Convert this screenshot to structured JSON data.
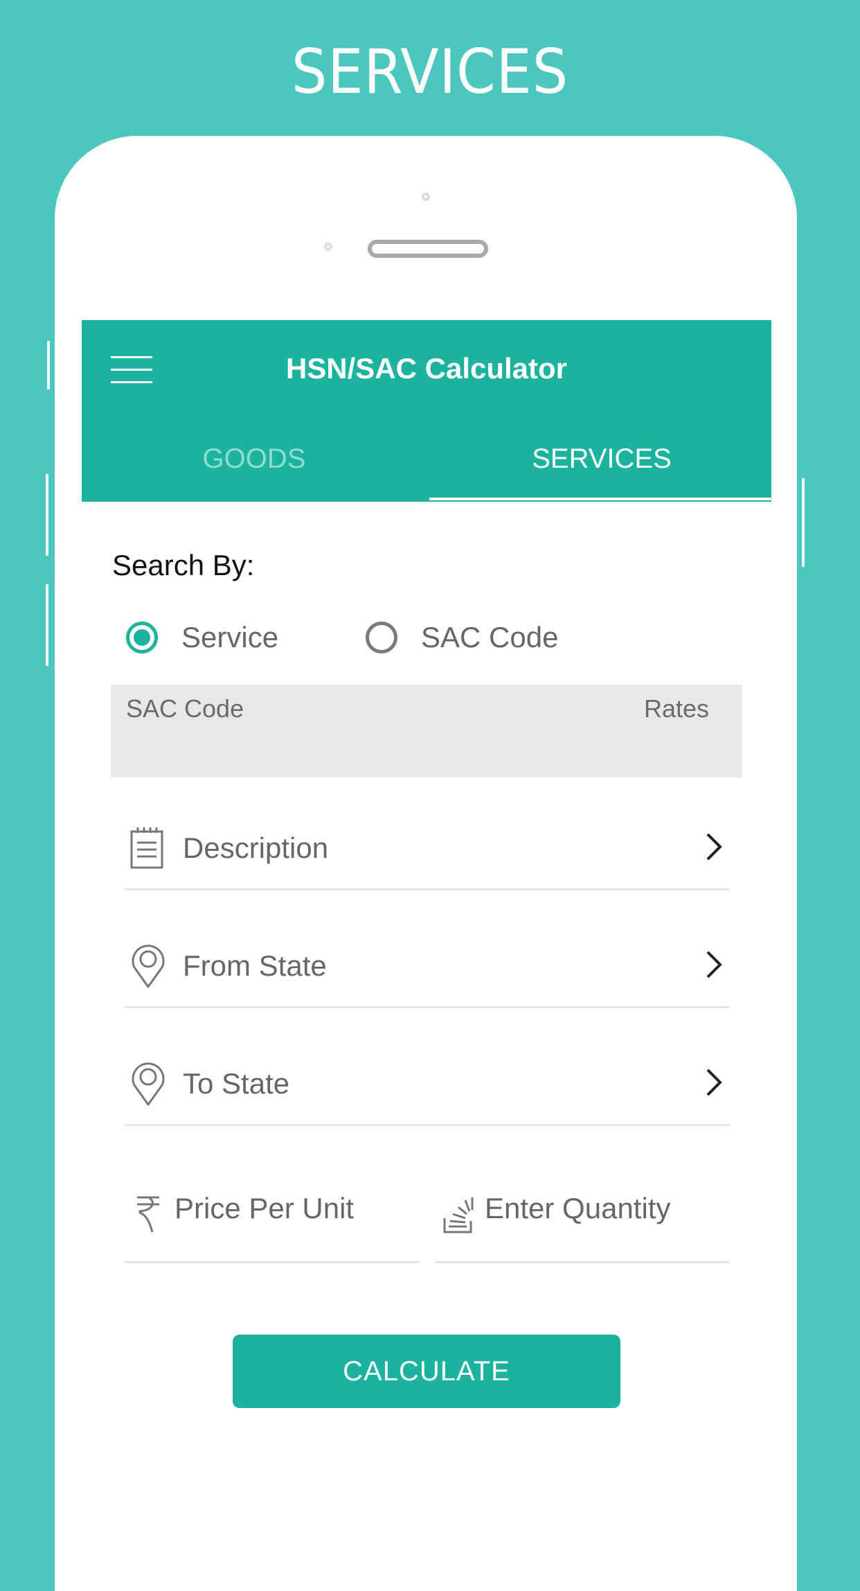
{
  "promo": {
    "title": "SERVICES"
  },
  "app": {
    "title": "HSN/SAC Calculator",
    "menu_icon": "hamburger-menu-icon",
    "tabs": [
      {
        "label": "GOODS",
        "active": false
      },
      {
        "label": "SERVICES",
        "active": true
      }
    ]
  },
  "search": {
    "label": "Search By:",
    "options": [
      {
        "label": "Service",
        "checked": true
      },
      {
        "label": "SAC Code",
        "checked": false
      }
    ]
  },
  "result": {
    "sac_code_label": "SAC Code",
    "rates_label": "Rates"
  },
  "rows": [
    {
      "label": "Description",
      "icon": "notepad-icon"
    },
    {
      "label": "From State",
      "icon": "location-pin-icon"
    },
    {
      "label": "To State",
      "icon": "location-pin-icon"
    }
  ],
  "inputs": {
    "price": {
      "placeholder": "Price Per Unit",
      "value": "",
      "icon": "rupee-icon"
    },
    "quantity": {
      "placeholder": "Enter Quantity",
      "value": "",
      "icon": "stack-icon"
    }
  },
  "calculate_label": "CALCULATE",
  "colors": {
    "accent": "#1bb39e",
    "background": "#4cc7bf"
  }
}
